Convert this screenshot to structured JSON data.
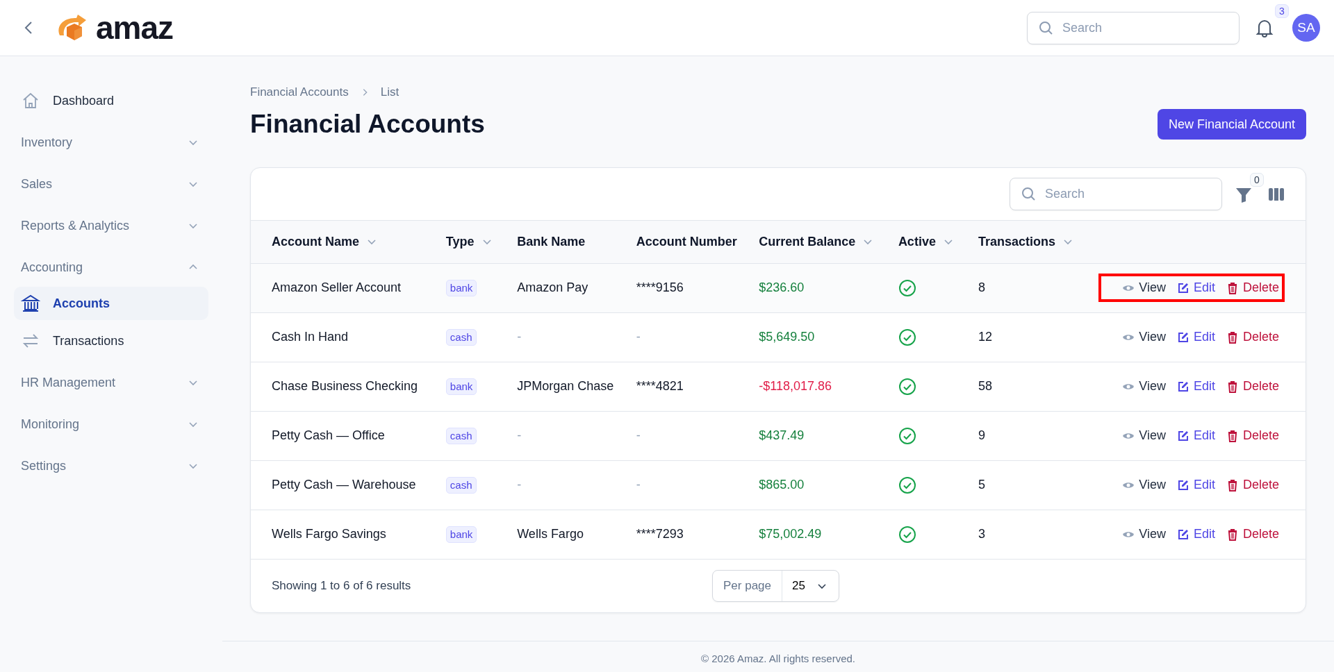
{
  "header": {
    "brand": "amaz",
    "search": {
      "placeholder": "Search"
    },
    "notifications": "3",
    "avatar": "SA"
  },
  "sidebar": {
    "items": [
      {
        "label": "Dashboard",
        "kind": "link",
        "selected": false
      },
      {
        "label": "Inventory",
        "kind": "group",
        "expanded": false
      },
      {
        "label": "Sales",
        "kind": "group",
        "expanded": false
      },
      {
        "label": "Reports & Analytics",
        "kind": "group",
        "expanded": false
      },
      {
        "label": "Accounting",
        "kind": "group",
        "expanded": true,
        "children": [
          {
            "label": "Accounts",
            "kind": "link",
            "selected": true
          },
          {
            "label": "Transactions",
            "kind": "link",
            "selected": false
          }
        ]
      },
      {
        "label": "HR Management",
        "kind": "group",
        "expanded": false
      },
      {
        "label": "Monitoring",
        "kind": "group",
        "expanded": false
      },
      {
        "label": "Settings",
        "kind": "group",
        "expanded": false
      }
    ]
  },
  "breadcrumb": [
    "Financial Accounts",
    "List"
  ],
  "page_title": "Financial Accounts",
  "primary_button": "New Financial Account",
  "table": {
    "search": {
      "placeholder": "Search"
    },
    "filter_count": "0",
    "columns": [
      {
        "label": "Account Name",
        "sortable": true
      },
      {
        "label": "Type",
        "sortable": true
      },
      {
        "label": "Bank Name",
        "sortable": false
      },
      {
        "label": "Account Number",
        "sortable": false
      },
      {
        "label": "Current Balance",
        "sortable": true
      },
      {
        "label": "Active",
        "sortable": true
      },
      {
        "label": "Transactions",
        "sortable": true
      }
    ],
    "rows": [
      {
        "name": "Amazon Seller Account",
        "type": "bank",
        "bank": "Amazon Pay",
        "number": "****9156",
        "balance": "$236.60",
        "negative": false,
        "active": true,
        "transactions": "8",
        "actions": [
          "View",
          "Edit",
          "Delete"
        ],
        "highlighted": true
      },
      {
        "name": "Cash In Hand",
        "type": "cash",
        "bank": "-",
        "number": "-",
        "balance": "$5,649.50",
        "negative": false,
        "active": true,
        "transactions": "12",
        "actions": [
          "View",
          "Edit",
          "Delete"
        ],
        "highlighted": false
      },
      {
        "name": "Chase Business Checking",
        "type": "bank",
        "bank": "JPMorgan Chase",
        "number": "****4821",
        "balance": "-$118,017.86",
        "negative": true,
        "active": true,
        "transactions": "58",
        "actions": [
          "View",
          "Edit",
          "Delete"
        ],
        "highlighted": false
      },
      {
        "name": "Petty Cash — Office",
        "type": "cash",
        "bank": "-",
        "number": "-",
        "balance": "$437.49",
        "negative": false,
        "active": true,
        "transactions": "9",
        "actions": [
          "View",
          "Edit",
          "Delete"
        ],
        "highlighted": false
      },
      {
        "name": "Petty Cash — Warehouse",
        "type": "cash",
        "bank": "-",
        "number": "-",
        "balance": "$865.00",
        "negative": false,
        "active": true,
        "transactions": "5",
        "actions": [
          "View",
          "Edit",
          "Delete"
        ],
        "highlighted": false
      },
      {
        "name": "Wells Fargo Savings",
        "type": "bank",
        "bank": "Wells Fargo",
        "number": "****7293",
        "balance": "$75,002.49",
        "negative": false,
        "active": true,
        "transactions": "3",
        "actions": [
          "View",
          "Edit",
          "Delete"
        ],
        "highlighted": false
      }
    ],
    "summary": "Showing 1 to 6 of 6 results",
    "per_page_label": "Per page",
    "per_page": "25"
  },
  "footer": "© 2026 Amaz. All rights reserved."
}
